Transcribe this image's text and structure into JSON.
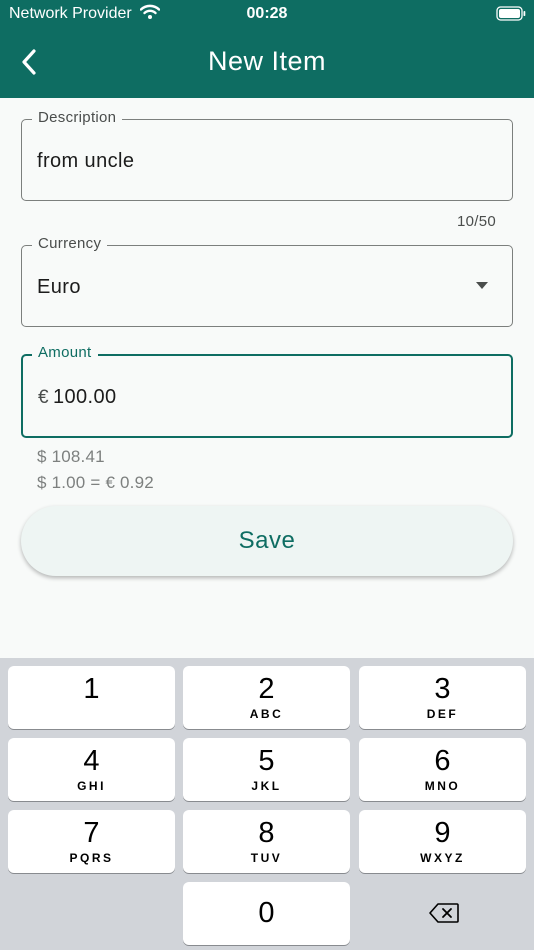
{
  "status_bar": {
    "carrier": "Network Provider",
    "time": "00:28"
  },
  "app_bar": {
    "title": "New Item",
    "back_icon": "chevron-left-icon"
  },
  "form": {
    "description": {
      "label": "Description",
      "value": "from uncle",
      "counter": "10/50"
    },
    "currency": {
      "label": "Currency",
      "value": "Euro"
    },
    "amount": {
      "label": "Amount",
      "prefix": "€",
      "value": "100.00"
    },
    "converted": "$ 108.41",
    "rate": "$ 1.00 = € 0.92"
  },
  "save_label": "Save",
  "keypad": [
    {
      "digit": "1",
      "letters": ""
    },
    {
      "digit": "2",
      "letters": "ABC"
    },
    {
      "digit": "3",
      "letters": "DEF"
    },
    {
      "digit": "4",
      "letters": "GHI"
    },
    {
      "digit": "5",
      "letters": "JKL"
    },
    {
      "digit": "6",
      "letters": "MNO"
    },
    {
      "digit": "7",
      "letters": "PQRS"
    },
    {
      "digit": "8",
      "letters": "TUV"
    },
    {
      "digit": "9",
      "letters": "WXYZ"
    },
    {
      "digit": "0",
      "letters": ""
    }
  ],
  "colors": {
    "primary": "#0e6d62",
    "background": "#f8faf9",
    "keyboard": "#d1d4d9"
  }
}
